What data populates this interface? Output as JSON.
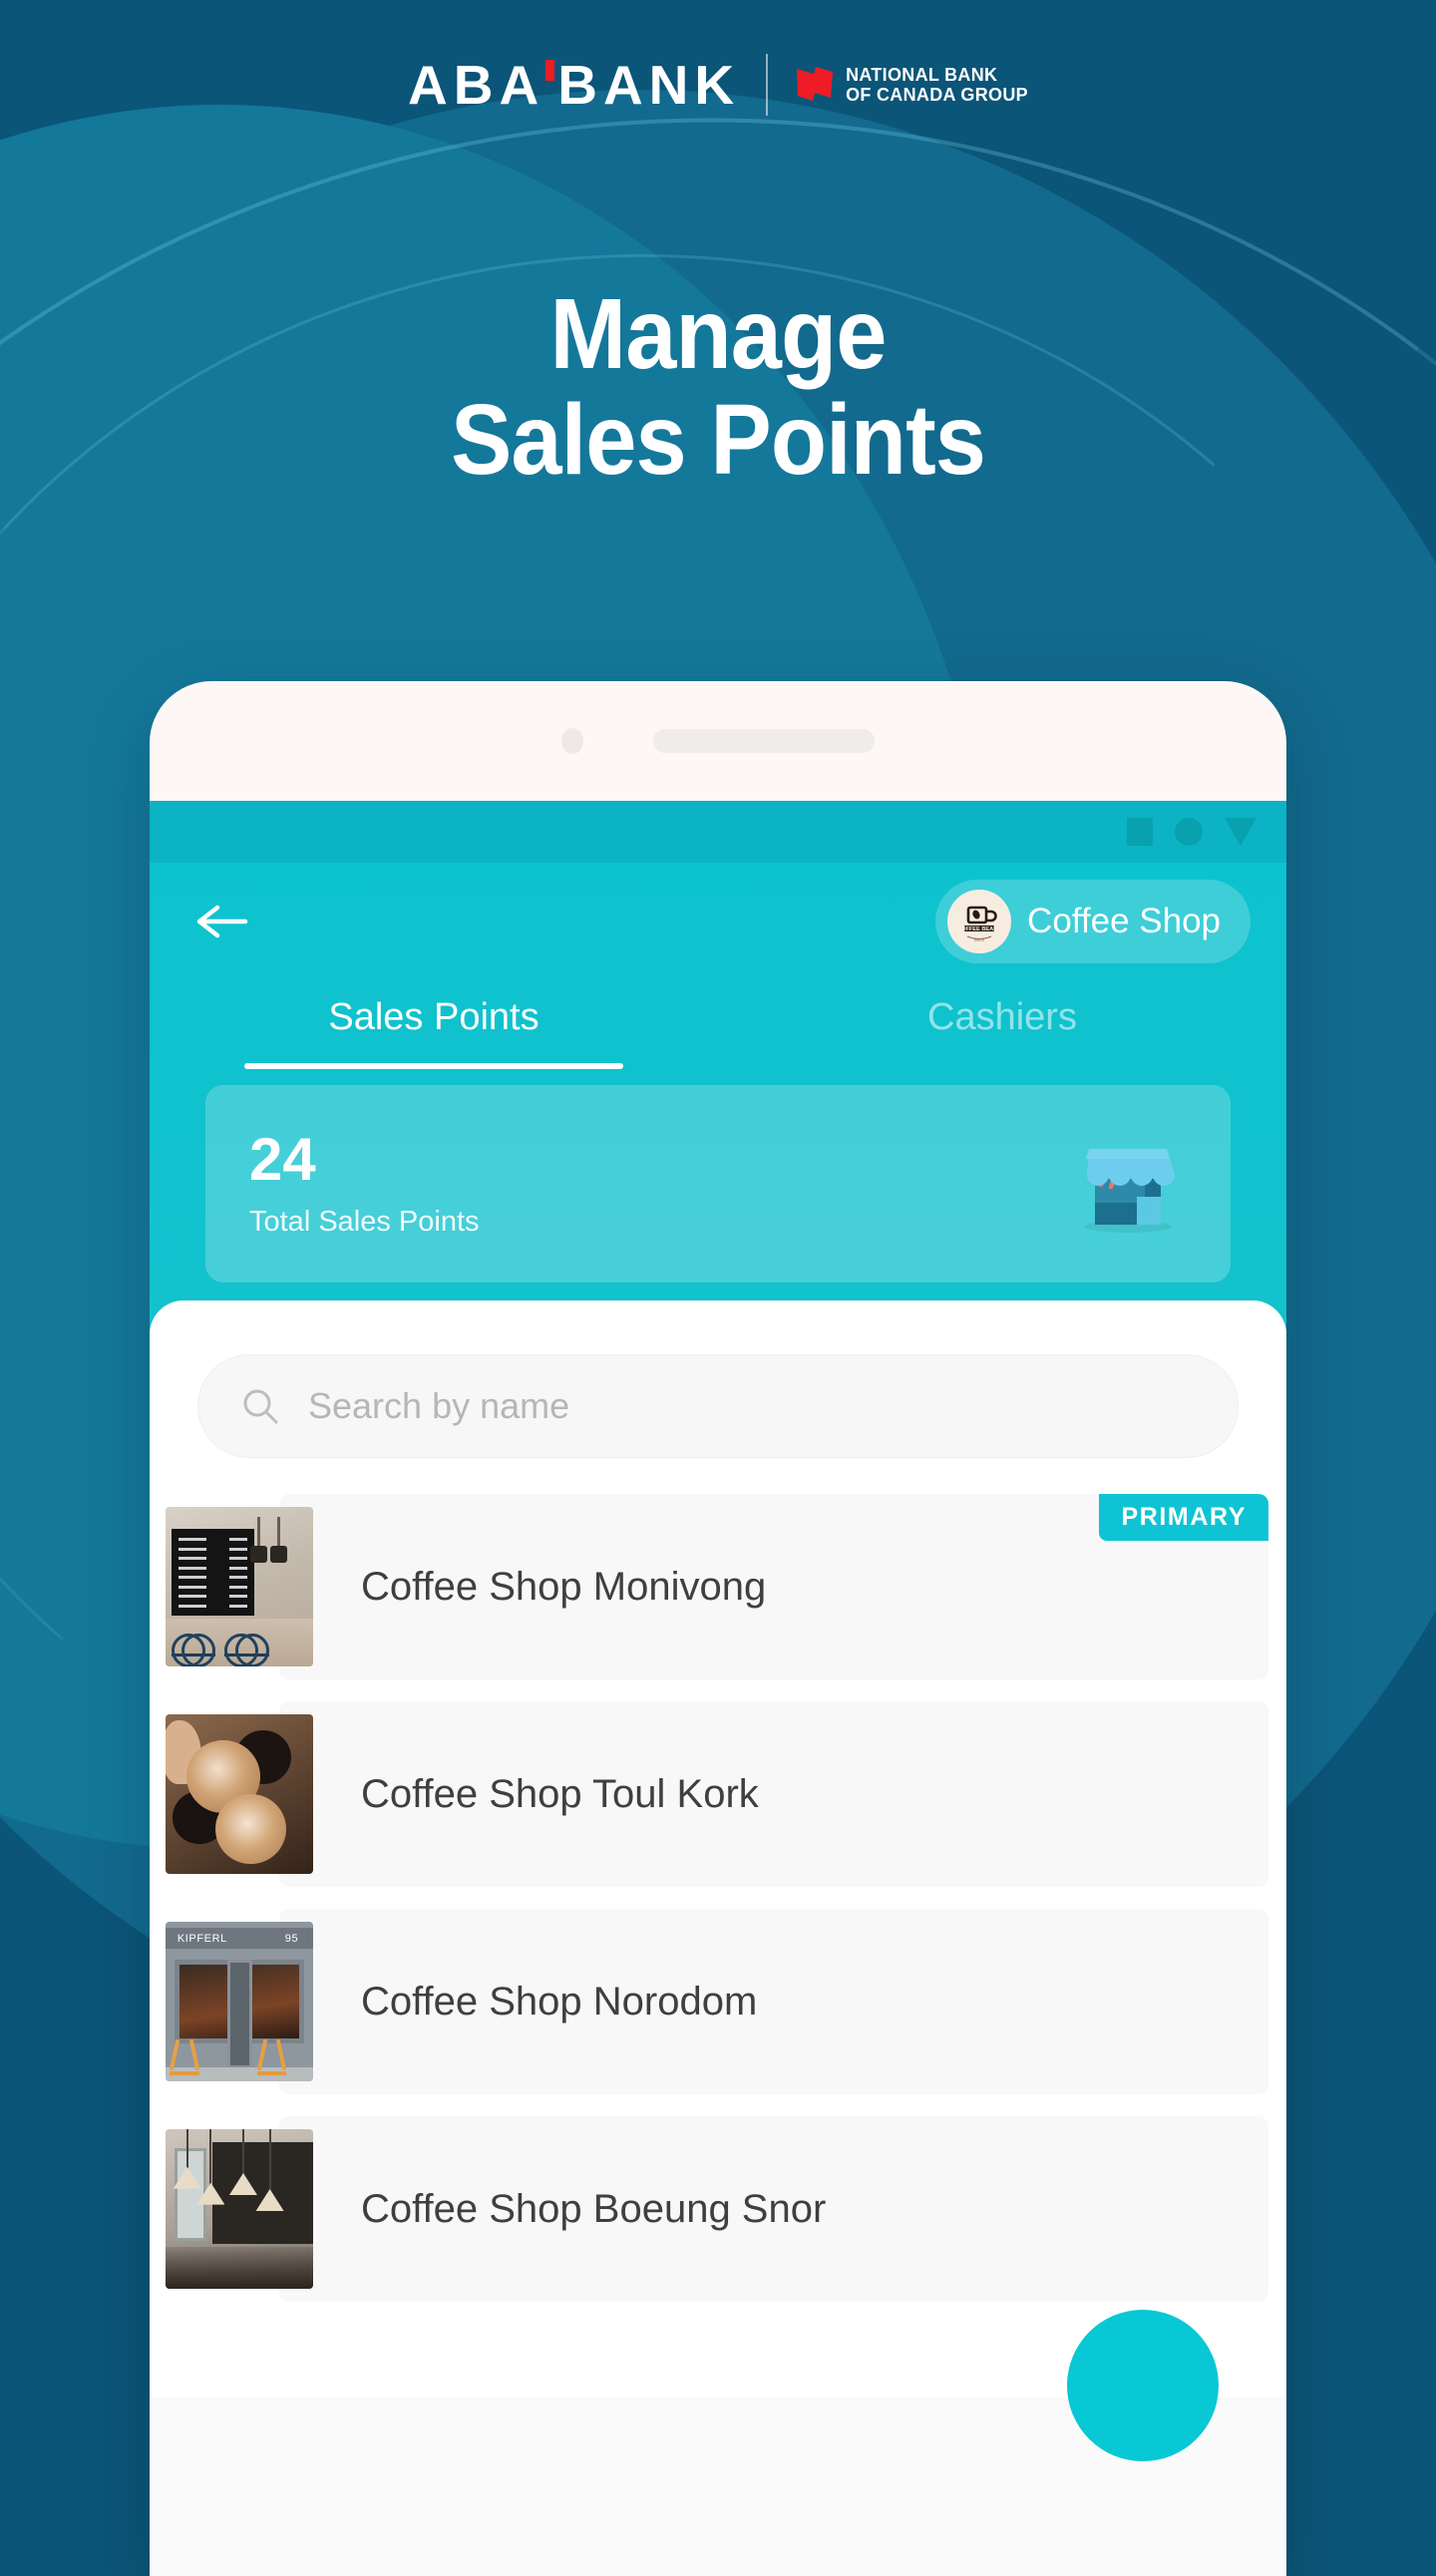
{
  "brand": {
    "name": "ABA",
    "name_suffix": "BANK",
    "partner_line1": "NATIONAL BANK",
    "partner_line2": "OF CANADA GROUP",
    "accent_red": "#ed1c24"
  },
  "headline": {
    "line1": "Manage",
    "line2": "Sales Points"
  },
  "app": {
    "statusbar": {
      "icons": [
        "square-icon",
        "circle-icon",
        "triangle-icon"
      ]
    },
    "header": {
      "back_icon": "back-arrow-icon",
      "shop_chip": {
        "label": "Coffee Shop",
        "logo_caption": "COFFEE BEANS",
        "logo_icon": "coffee-cup-icon"
      },
      "accent": "#0fc1ce"
    },
    "tabs": [
      {
        "label": "Sales Points",
        "active": true
      },
      {
        "label": "Cashiers",
        "active": false
      }
    ],
    "stat_card": {
      "value": "24",
      "label": "Total Sales Points",
      "icon": "storefront-icon"
    },
    "search": {
      "placeholder": "Search by name",
      "value": "",
      "icon": "search-icon"
    },
    "list": [
      {
        "title": "Coffee Shop Monivong",
        "badge": "PRIMARY",
        "scene": "sc1"
      },
      {
        "title": "Coffee Shop Toul Kork",
        "badge": "",
        "scene": "sc2"
      },
      {
        "title": "Coffee Shop Norodom",
        "badge": "",
        "scene": "sc3",
        "sign_left": "KIPFERL",
        "sign_right": "95"
      },
      {
        "title": "Coffee Shop Boeung Snor",
        "badge": "",
        "scene": "sc4"
      }
    ],
    "fab": {
      "icon": "add-icon",
      "color": "#07c8d4"
    }
  }
}
